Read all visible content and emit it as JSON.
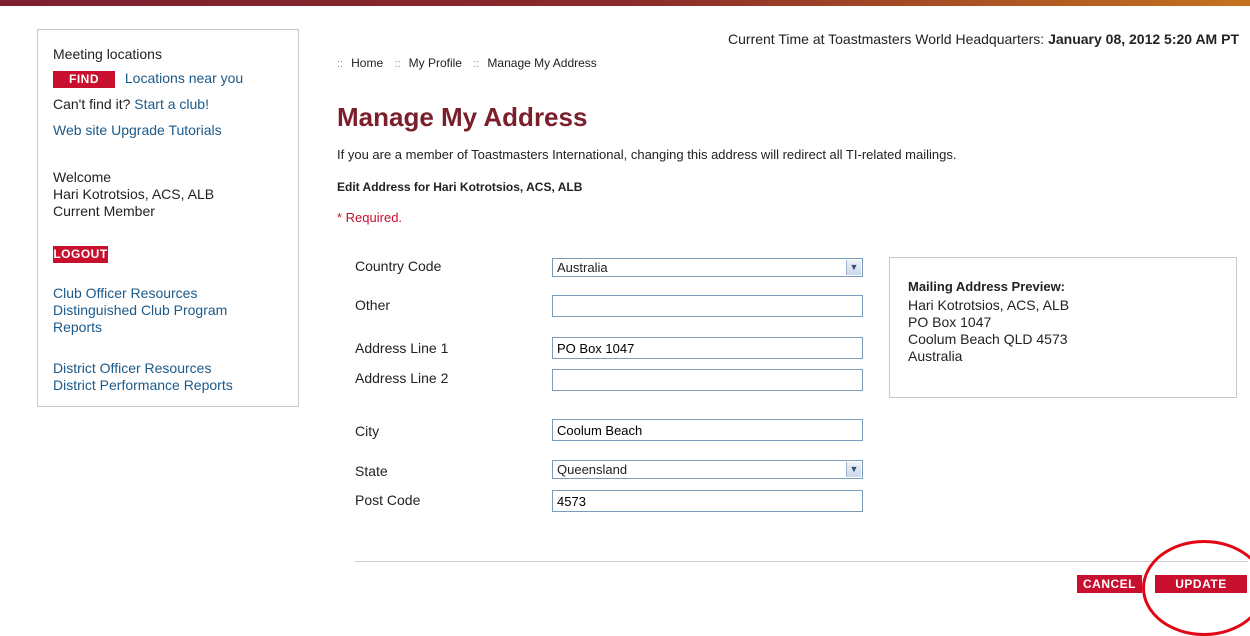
{
  "sidebar": {
    "meeting_label": "Meeting locations",
    "find_label": "FIND",
    "locations_link": "Locations near you",
    "cant_find": "Can't find it?",
    "start_club_link": "Start a club!",
    "tutorials_link": "Web site Upgrade Tutorials",
    "welcome": "Welcome",
    "user_name": "Hari Kotrotsios, ACS, ALB",
    "member_status": "Current Member",
    "logout_label": "LOGOUT",
    "club_officer_link": "Club Officer Resources",
    "dcp_reports_link_line1": "Distinguished Club Program",
    "dcp_reports_link_line2": "Reports",
    "district_officer_link": "District Officer Resources",
    "district_performance_link": "District Performance Reports"
  },
  "header": {
    "time_label": "Current Time at Toastmasters World Headquarters:",
    "time_value": "January 08, 2012 5:20 AM PT"
  },
  "breadcrumb": {
    "separator": "::",
    "items": [
      "Home",
      "My Profile",
      "Manage My Address"
    ]
  },
  "main": {
    "title": "Manage My Address",
    "intro": "If you are a member of Toastmasters International, changing this address will redirect all TI-related mailings.",
    "edit_heading": "Edit Address for Hari Kotrotsios, ACS, ALB",
    "required_note": "* Required."
  },
  "form": {
    "country_code": {
      "label": "Country Code",
      "value": "Australia"
    },
    "other": {
      "label": "Other",
      "value": ""
    },
    "address1": {
      "label": "Address Line 1",
      "value": "PO Box 1047"
    },
    "address2": {
      "label": "Address Line 2",
      "value": ""
    },
    "city": {
      "label": "City",
      "value": "Coolum Beach"
    },
    "state": {
      "label": "State",
      "value": "Queensland"
    },
    "post_code": {
      "label": "Post Code",
      "value": "4573"
    }
  },
  "preview": {
    "heading": "Mailing Address Preview:",
    "line1": "Hari Kotrotsios, ACS, ALB",
    "line2": "PO Box 1047",
    "line3": "Coolum Beach QLD 4573",
    "line4": "Australia"
  },
  "actions": {
    "cancel_label": "CANCEL",
    "update_label": "UPDATE"
  },
  "colors": {
    "brand_red": "#c8102e",
    "title_maroon": "#7a1f2b",
    "link_blue": "#1b5a8a",
    "annotation_red": "#e20613"
  },
  "icons": {
    "dropdown": "chevron-down-icon",
    "annotation": "highlight-circle"
  }
}
